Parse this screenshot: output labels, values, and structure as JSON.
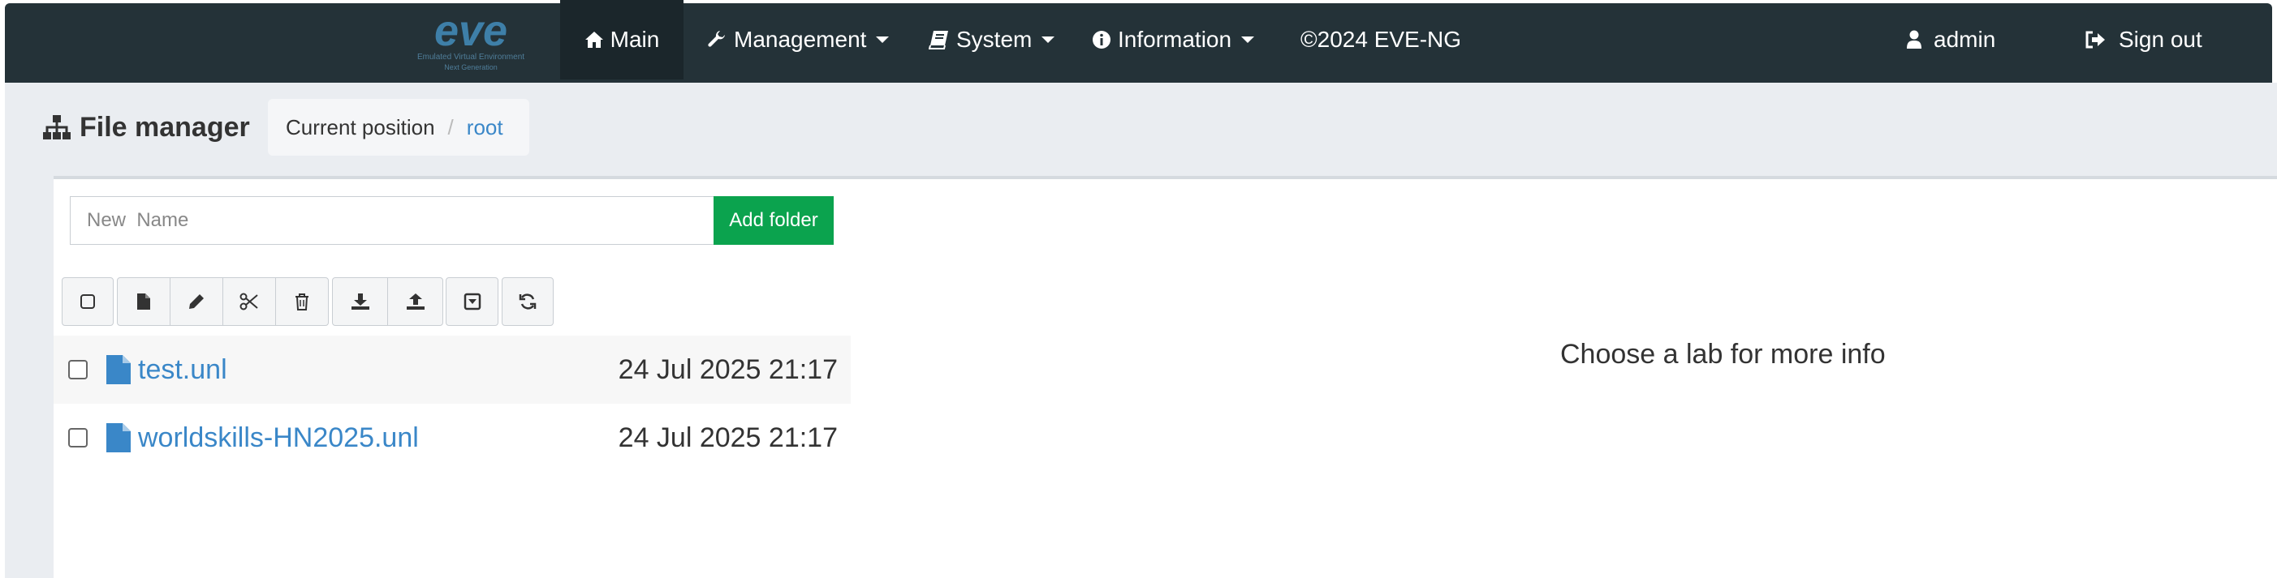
{
  "navbar": {
    "logo_text": "eve",
    "logo_subtitle_1": "Emulated Virtual Environment",
    "logo_subtitle_2": "Next Generation",
    "main_label": "Main",
    "management_label": "Management",
    "system_label": "System",
    "information_label": "Information",
    "copyright_label": "©2024 EVE-NG",
    "user_label": "admin",
    "signout_label": "Sign out"
  },
  "header": {
    "title": "File manager",
    "breadcrumb_prefix": "Current position",
    "breadcrumb_separator": "/",
    "breadcrumb_current": "root"
  },
  "folder_form": {
    "placeholder": "New  Name",
    "add_button": "Add folder"
  },
  "toolbar": {
    "icons": [
      "checkbox-icon",
      "new-file-icon",
      "pencil-icon",
      "scissors-icon",
      "trash-icon",
      "download-icon",
      "upload-icon",
      "dropdown-box-icon",
      "refresh-icon"
    ]
  },
  "files": [
    {
      "name": "test.unl",
      "date": "24 Jul 2025 21:17"
    },
    {
      "name": "worldskills-HN2025.unl",
      "date": "24 Jul 2025 21:17"
    }
  ],
  "info_panel": {
    "message": "Choose a lab for more info"
  },
  "colors": {
    "navbar_bg": "#243238",
    "link": "#3a87c8",
    "add_button": "#0ba34e"
  }
}
